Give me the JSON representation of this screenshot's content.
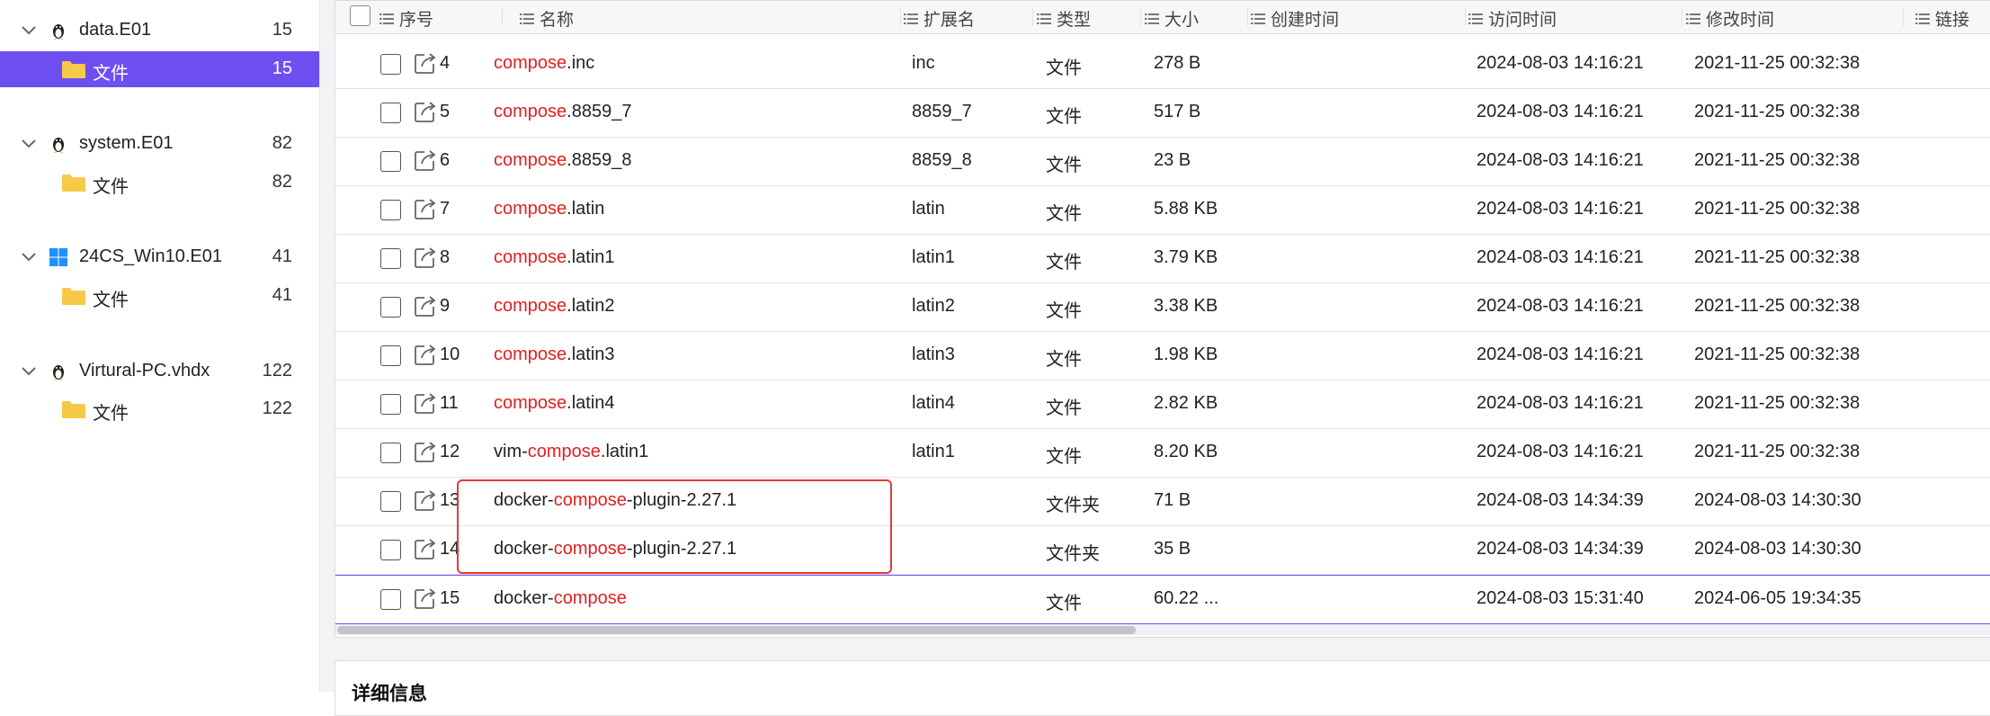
{
  "sidebar": {
    "groups": [
      {
        "name": "data.E01",
        "count": "15",
        "os": "linux",
        "child": {
          "label": "文件",
          "count": "15",
          "selected": true
        }
      },
      {
        "name": "system.E01",
        "count": "82",
        "os": "linux",
        "child": {
          "label": "文件",
          "count": "82",
          "selected": false
        }
      },
      {
        "name": "24CS_Win10.E01",
        "count": "41",
        "os": "windows",
        "child": {
          "label": "文件",
          "count": "41",
          "selected": false
        }
      },
      {
        "name": "Virtural-PC.vhdx",
        "count": "122",
        "os": "linux",
        "child": {
          "label": "文件",
          "count": "122",
          "selected": false
        }
      }
    ]
  },
  "table": {
    "headers": {
      "index": "序号",
      "name": "名称",
      "ext": "扩展名",
      "type": "类型",
      "size": "大小",
      "created": "创建时间",
      "accessed": "访问时间",
      "modified": "修改时间",
      "link": "链接"
    },
    "highlight_color": "#e02020",
    "rows": [
      {
        "index": "4",
        "name_pre": "",
        "name_hl": "compose",
        "name_post": ".inc",
        "ext": "inc",
        "type": "文件",
        "size": "278 B",
        "created": "",
        "accessed": "2024-08-03 14:16:21",
        "modified": "2021-11-25 00:32:38"
      },
      {
        "index": "5",
        "name_pre": "",
        "name_hl": "compose",
        "name_post": ".8859_7",
        "ext": "8859_7",
        "type": "文件",
        "size": "517 B",
        "created": "",
        "accessed": "2024-08-03 14:16:21",
        "modified": "2021-11-25 00:32:38"
      },
      {
        "index": "6",
        "name_pre": "",
        "name_hl": "compose",
        "name_post": ".8859_8",
        "ext": "8859_8",
        "type": "文件",
        "size": "23 B",
        "created": "",
        "accessed": "2024-08-03 14:16:21",
        "modified": "2021-11-25 00:32:38"
      },
      {
        "index": "7",
        "name_pre": "",
        "name_hl": "compose",
        "name_post": ".latin",
        "ext": "latin",
        "type": "文件",
        "size": "5.88 KB",
        "created": "",
        "accessed": "2024-08-03 14:16:21",
        "modified": "2021-11-25 00:32:38"
      },
      {
        "index": "8",
        "name_pre": "",
        "name_hl": "compose",
        "name_post": ".latin1",
        "ext": "latin1",
        "type": "文件",
        "size": "3.79 KB",
        "created": "",
        "accessed": "2024-08-03 14:16:21",
        "modified": "2021-11-25 00:32:38"
      },
      {
        "index": "9",
        "name_pre": "",
        "name_hl": "compose",
        "name_post": ".latin2",
        "ext": "latin2",
        "type": "文件",
        "size": "3.38 KB",
        "created": "",
        "accessed": "2024-08-03 14:16:21",
        "modified": "2021-11-25 00:32:38"
      },
      {
        "index": "10",
        "name_pre": "",
        "name_hl": "compose",
        "name_post": ".latin3",
        "ext": "latin3",
        "type": "文件",
        "size": "1.98 KB",
        "created": "",
        "accessed": "2024-08-03 14:16:21",
        "modified": "2021-11-25 00:32:38"
      },
      {
        "index": "11",
        "name_pre": "",
        "name_hl": "compose",
        "name_post": ".latin4",
        "ext": "latin4",
        "type": "文件",
        "size": "2.82 KB",
        "created": "",
        "accessed": "2024-08-03 14:16:21",
        "modified": "2021-11-25 00:32:38"
      },
      {
        "index": "12",
        "name_pre": "vim-",
        "name_hl": "compose",
        "name_post": ".latin1",
        "ext": "latin1",
        "type": "文件",
        "size": "8.20 KB",
        "created": "",
        "accessed": "2024-08-03 14:16:21",
        "modified": "2021-11-25 00:32:38"
      },
      {
        "index": "13",
        "name_pre": "docker-",
        "name_hl": "compose",
        "name_post": "-plugin-2.27.1",
        "ext": "",
        "type": "文件夹",
        "size": "71 B",
        "created": "",
        "accessed": "2024-08-03 14:34:39",
        "modified": "2024-08-03 14:30:30"
      },
      {
        "index": "14",
        "name_pre": "docker-",
        "name_hl": "compose",
        "name_post": "-plugin-2.27.1",
        "ext": "",
        "type": "文件夹",
        "size": "35 B",
        "created": "",
        "accessed": "2024-08-03 14:34:39",
        "modified": "2024-08-03 14:30:30"
      },
      {
        "index": "15",
        "name_pre": "docker-",
        "name_hl": "compose",
        "name_post": "",
        "ext": "",
        "type": "文件",
        "size": "60.22 ...",
        "created": "",
        "accessed": "2024-08-03 15:31:40",
        "modified": "2024-06-05 19:34:35"
      }
    ]
  },
  "details": {
    "title": "详细信息"
  },
  "colors": {
    "accent": "#6d4ff0",
    "annotation": "#e53935",
    "folder": "#f7c948"
  }
}
